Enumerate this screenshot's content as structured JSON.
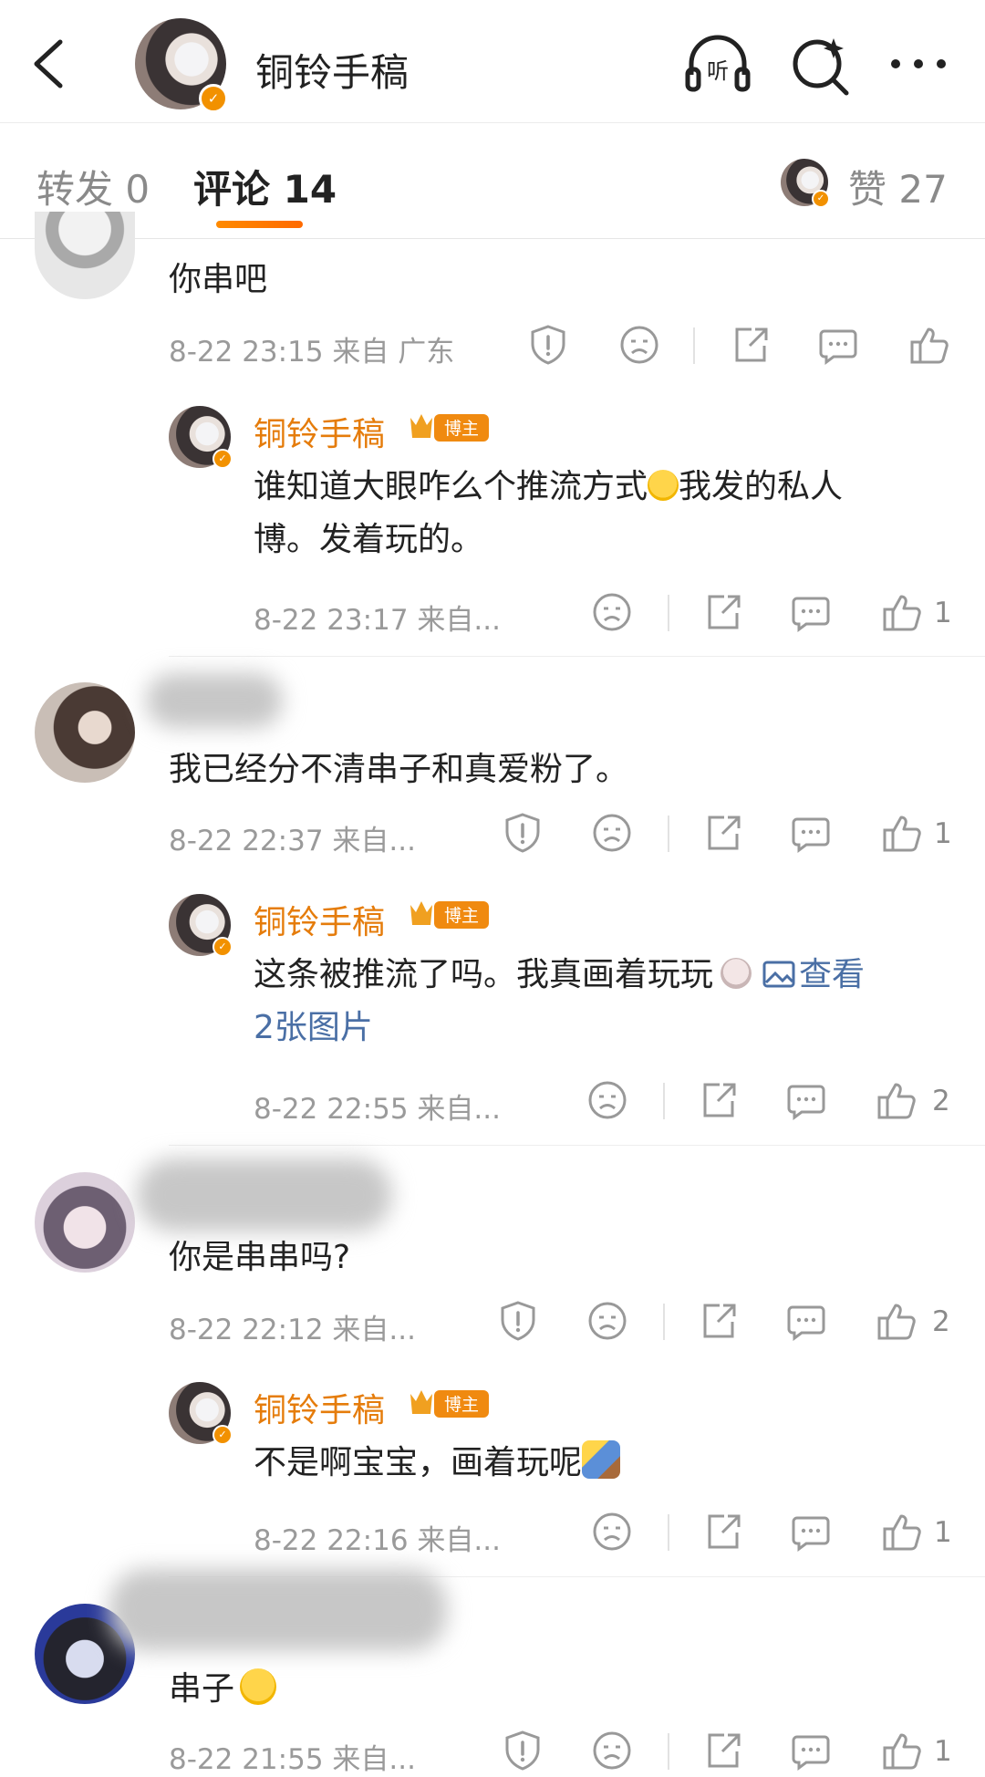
{
  "header": {
    "title": "铜铃手稿",
    "listen_label": "听"
  },
  "tabs": {
    "repost": "转发 0",
    "comment": "评论 14",
    "like": "赞 27"
  },
  "blogger_badge": "博主",
  "comments": [
    {
      "text": "你串吧",
      "meta": "8-22 23:15 来自 广东",
      "likes": ""
    },
    {
      "author": "铜铃手稿",
      "text": "谁知道大眼咋么个推流方式😭我发的私人博。发着玩的。",
      "text_line1": "谁知道大眼咋么个推流方式",
      "text_line1_tail": "我发的私人",
      "text_line2": "博。发着玩的。",
      "meta": "8-22 23:17 来自...",
      "likes": "1"
    },
    {
      "text": "我已经分不清串子和真爱粉了。",
      "meta": "8-22 22:37 来自...",
      "likes": "1"
    },
    {
      "author": "铜铃手稿",
      "text_line1": "这条被推流了吗。我真画着玩玩",
      "link_label": "查看",
      "link_line2": "2张图片",
      "meta": "8-22 22:55 来自...",
      "likes": "2"
    },
    {
      "text": "你是串串吗?",
      "meta": "8-22 22:12 来自...",
      "likes": "2"
    },
    {
      "author": "铜铃手稿",
      "text": "不是啊宝宝，画着玩呢",
      "meta": "8-22 22:16 来自...",
      "likes": "1"
    },
    {
      "text": "串子",
      "meta": "8-22 21:55 来自...",
      "likes": "1"
    }
  ],
  "colors": {
    "accent": "#e57c0b",
    "link": "#4a6fa5",
    "meta": "#9a9a9a"
  }
}
